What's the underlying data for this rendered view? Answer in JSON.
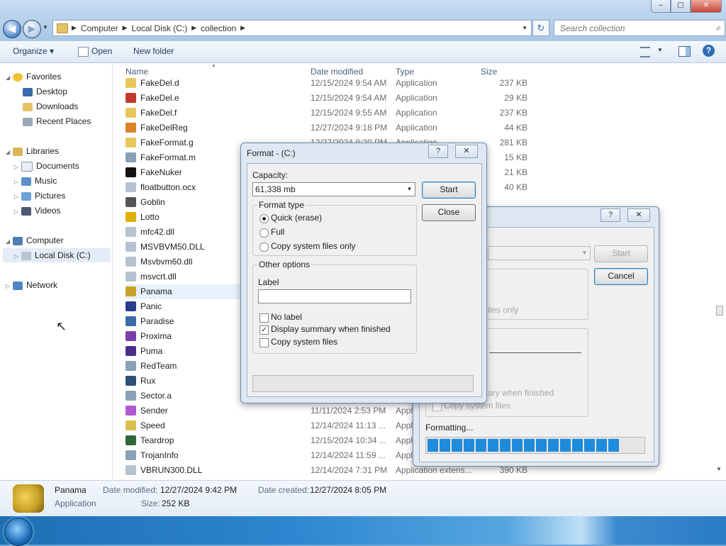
{
  "window": {
    "caption_buttons": [
      "–",
      "▢",
      "✕"
    ]
  },
  "address_bar": {
    "crumbs": [
      "Computer",
      "Local Disk (C:)",
      "collection"
    ],
    "search_placeholder": "Search collection"
  },
  "toolbar": {
    "organize": "Organize ▾",
    "open": "Open",
    "new_folder": "New folder"
  },
  "nav": {
    "favorites": "Favorites",
    "desktop": "Desktop",
    "downloads": "Downloads",
    "recent_places": "Recent Places",
    "libraries": "Libraries",
    "documents": "Documents",
    "music": "Music",
    "pictures": "Pictures",
    "videos": "Videos",
    "computer": "Computer",
    "local_disk": "Local Disk (C:)",
    "network": "Network"
  },
  "columns": {
    "name": "Name",
    "date": "Date modified",
    "type": "Type",
    "size": "Size"
  },
  "files": [
    {
      "name": "FakeDel.d",
      "date": "12/15/2024 9:54 AM",
      "type": "Application",
      "size": "237 KB",
      "color": "#e8c85a"
    },
    {
      "name": "FakeDel.e",
      "date": "12/15/2024 9:54 AM",
      "type": "Application",
      "size": "29 KB",
      "color": "#c0392b"
    },
    {
      "name": "FakeDel.f",
      "date": "12/15/2024 9:55 AM",
      "type": "Application",
      "size": "237 KB",
      "color": "#e8c85a"
    },
    {
      "name": "FakeDelReg",
      "date": "12/27/2024 9:18 PM",
      "type": "Application",
      "size": "44 KB",
      "color": "#d9822b"
    },
    {
      "name": "FakeFormat.g",
      "date": "12/27/2024 9:20 PM",
      "type": "Application",
      "size": "281 KB",
      "color": "#e8c85a"
    },
    {
      "name": "FakeFormat.m",
      "date": "",
      "type": "",
      "size": "15 KB",
      "color": "#8aa0b6"
    },
    {
      "name": "FakeNuker",
      "date": "",
      "type": "",
      "size": "21 KB",
      "color": "#111111"
    },
    {
      "name": "floatbutton.ocx",
      "date": "",
      "type": "",
      "size": "40 KB",
      "color": "#b5c3d1"
    },
    {
      "name": "Goblin",
      "date": "",
      "type": "",
      "size": "",
      "color": "#555555"
    },
    {
      "name": "Lotto",
      "date": "",
      "type": "",
      "size": "",
      "color": "#e0b000"
    },
    {
      "name": "mfc42.dll",
      "date": "",
      "type": "",
      "size": "",
      "color": "#b5c3d1"
    },
    {
      "name": "MSVBVM50.DLL",
      "date": "",
      "type": "",
      "size": "",
      "color": "#b5c3d1"
    },
    {
      "name": "Msvbvm60.dll",
      "date": "",
      "type": "",
      "size": "",
      "color": "#b5c3d1"
    },
    {
      "name": "msvcrt.dll",
      "date": "",
      "type": "",
      "size": "",
      "color": "#b5c3d1"
    },
    {
      "name": "Panama",
      "date": "",
      "type": "",
      "size": "",
      "color": "#c9a227"
    },
    {
      "name": "Panic",
      "date": "",
      "type": "",
      "size": "",
      "color": "#2a3c8c"
    },
    {
      "name": "Paradise",
      "date": "",
      "type": "",
      "size": "",
      "color": "#3a6aa8"
    },
    {
      "name": "Proxima",
      "date": "",
      "type": "",
      "size": "",
      "color": "#7b3fa8"
    },
    {
      "name": "Puma",
      "date": "",
      "type": "",
      "size": "",
      "color": "#4b2d8a"
    },
    {
      "name": "RedTeam",
      "date": "",
      "type": "",
      "size": "",
      "color": "#8aa0b6"
    },
    {
      "name": "Rux",
      "date": "",
      "type": "",
      "size": "",
      "color": "#2d4f78"
    },
    {
      "name": "Sector.a",
      "date": "",
      "type": "",
      "size": "",
      "color": "#8aa0b6"
    },
    {
      "name": "Sender",
      "date": "11/11/2024 2:53 PM",
      "type": "Appl",
      "size": "",
      "color": "#b05ad0"
    },
    {
      "name": "Speed",
      "date": "12/14/2024 11:13 ...",
      "type": "Appl",
      "size": "",
      "color": "#d9c04a"
    },
    {
      "name": "Teardrop",
      "date": "12/15/2024 10:34 ...",
      "type": "Appl",
      "size": "",
      "color": "#2d6a3a"
    },
    {
      "name": "TrojanInfo",
      "date": "12/14/2024 11:59 ...",
      "type": "Appl",
      "size": "",
      "color": "#8aa0b6"
    },
    {
      "name": "VBRUN300.DLL",
      "date": "12/14/2024 7:31 PM",
      "type": "Application extens...",
      "size": "390 KB",
      "color": "#b5c3d1"
    }
  ],
  "details": {
    "name": "Panama",
    "kind": "Application",
    "date_modified_label": "Date modified:",
    "date_modified": "12/27/2024 9:42 PM",
    "date_created_label": "Date created:",
    "date_created": "12/27/2024 8:05 PM",
    "size_label": "Size:",
    "size": "252 KB"
  },
  "format_front": {
    "title": "Format - (C:)",
    "capacity_label": "Capacity:",
    "capacity_value": "61,338 mb",
    "start": "Start",
    "close": "Close",
    "format_type_label": "Format type",
    "quick": "Quick (erase)",
    "full": "Full",
    "copy_sys_only": "Copy system files only",
    "other_options": "Other options",
    "label_label": "Label",
    "no_label": "No label",
    "display_summary": "Display summary when finished",
    "copy_sys": "Copy system files"
  },
  "format_back": {
    "start": "Start",
    "cancel": "Cancel",
    "files_only": "iles only",
    "summary_tail": "ary when finished",
    "copy_sys": "Copy system files",
    "formatting": "Formatting...",
    "progress": 0.89
  }
}
